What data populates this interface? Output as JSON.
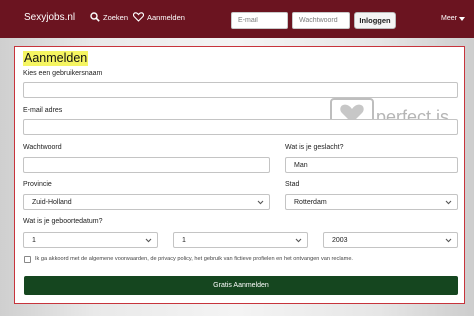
{
  "nav": {
    "brand": "Sexyjobs.nl",
    "search_label": "Zoeken",
    "register_label": "Aanmelden",
    "email_placeholder": "E-mail",
    "password_placeholder": "Wachtwoord",
    "login_label": "Inloggen",
    "more_label": "Meer"
  },
  "form": {
    "title": "Aanmelden",
    "username_label": "Kies een gebruikersnaam",
    "username_value": "",
    "email_label": "E-mail adres",
    "email_value": "",
    "password_label": "Wachtwoord",
    "password_value": "",
    "gender_label": "Wat is je geslacht?",
    "gender_value": "Man",
    "province_label": "Provincie",
    "province_value": "Zuid-Holland",
    "city_label": "Stad",
    "city_value": "Rotterdam",
    "birthdate_label": "Wat is je geboortedatum?",
    "birth_day": "1",
    "birth_month": "1",
    "birth_year": "2003",
    "agree_text": "Ik ga akkoord met de algemene voorwaarden, de privacy policy, het gebruik van fictieve profielen en het ontvangen van reclame.",
    "submit_label": "Gratis Aanmelden"
  },
  "watermark": {
    "text": "perfect.is"
  },
  "colors": {
    "navbar": "#6b1420",
    "panel_border": "#c7343c",
    "submit": "#15461f",
    "title_highlight": "#f5f562"
  }
}
